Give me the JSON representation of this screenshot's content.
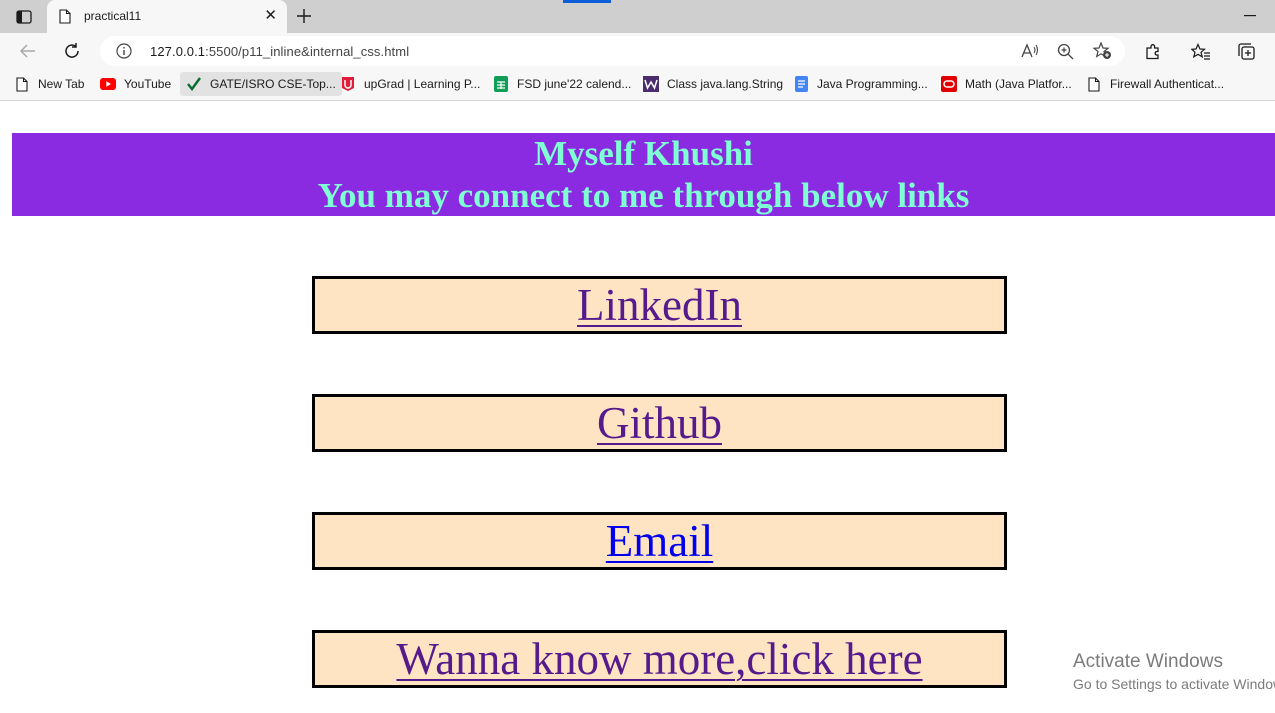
{
  "browser": {
    "tab": {
      "title": "practical11",
      "close": "✕"
    },
    "new_tab": "+",
    "minimize": "—",
    "address": {
      "host": "127.0.0.1",
      "rest": ":5500/p11_inline&internal_css.html"
    },
    "bookmarks": [
      {
        "label": "New Tab",
        "icon": "page-icon"
      },
      {
        "label": "YouTube",
        "icon": "youtube-icon"
      },
      {
        "label": "GATE/ISRO CSE-Top...",
        "icon": "checkmark-icon"
      },
      {
        "label": "upGrad | Learning P...",
        "icon": "upgrad-icon"
      },
      {
        "label": "FSD june'22 calend...",
        "icon": "sheets-icon"
      },
      {
        "label": "Class java.lang.String",
        "icon": "w-icon"
      },
      {
        "label": "Java Programming...",
        "icon": "docs-icon"
      },
      {
        "label": "Math (Java Platfor...",
        "icon": "oracle-icon"
      },
      {
        "label": "Firewall Authenticat...",
        "icon": "page-icon"
      }
    ]
  },
  "page": {
    "heading_line1": "Myself Khushi",
    "heading_line2": "You may connect to me through below links",
    "links": [
      {
        "label": "LinkedIn",
        "visited": true
      },
      {
        "label": "Github",
        "visited": true
      },
      {
        "label": "Email",
        "visited": false
      },
      {
        "label": "Wanna know more,click here",
        "visited": true
      }
    ]
  },
  "watermark": {
    "line1": "Activate Windows",
    "line2": "Go to Settings to activate Windows."
  },
  "colors": {
    "header_bg": "#8a2be2",
    "header_text": "#7fffd4",
    "linkbox_bg": "#ffe4c4",
    "visited_link": "#551a8b",
    "unvisited_link": "#0000ee"
  }
}
